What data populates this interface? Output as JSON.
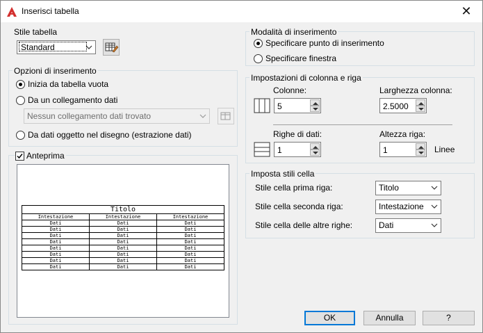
{
  "window": {
    "title": "Inserisci tabella",
    "close_glyph": "✕"
  },
  "stile_tabella": {
    "label": "Stile tabella",
    "value": "Standard"
  },
  "opzioni": {
    "label": "Opzioni di inserimento",
    "opt1": "Inizia da tabella vuota",
    "opt2": "Da un collegamento dati",
    "link_value": "Nessun collegamento dati trovato",
    "opt3": "Da dati oggetto nel disegno (estrazione dati)",
    "selected": "opt1"
  },
  "anteprima": {
    "label": "Anteprima",
    "checked": true,
    "table": {
      "title": "Titolo",
      "header": [
        "Intestazione",
        "Intestazione",
        "Intestazione"
      ],
      "rows": [
        [
          "Dati",
          "Dati",
          "Dati"
        ],
        [
          "Dati",
          "Dati",
          "Dati"
        ],
        [
          "Dati",
          "Dati",
          "Dati"
        ],
        [
          "Dati",
          "Dati",
          "Dati"
        ],
        [
          "Dati",
          "Dati",
          "Dati"
        ],
        [
          "Dati",
          "Dati",
          "Dati"
        ],
        [
          "Dati",
          "Dati",
          "Dati"
        ],
        [
          "Dati",
          "Dati",
          "Dati"
        ]
      ]
    }
  },
  "modalita": {
    "label": "Modalità di inserimento",
    "opt1": "Specificare punto di inserimento",
    "opt2": "Specificare finestra",
    "selected": "opt1"
  },
  "impostazioni": {
    "label": "Impostazioni di colonna e riga",
    "colonne_label": "Colonne:",
    "colonne_value": "5",
    "larghezza_label": "Larghezza colonna:",
    "larghezza_value": "2.5000",
    "righe_label": "Righe di dati:",
    "righe_value": "1",
    "altezza_label": "Altezza riga:",
    "altezza_value": "1",
    "linee_label": "Linee"
  },
  "stili_cella": {
    "label": "Imposta stili cella",
    "prima_label": "Stile cella prima riga:",
    "prima_value": "Titolo",
    "seconda_label": "Stile cella seconda riga:",
    "seconda_value": "Intestazione",
    "altre_label": "Stile cella delle altre righe:",
    "altre_value": "Dati"
  },
  "buttons": {
    "ok": "OK",
    "annulla": "Annulla",
    "help": "?"
  },
  "colors": {
    "accent": "#0078d7",
    "app_icon": "#d3302f"
  },
  "icons": [
    "autocad-app-icon",
    "close-icon",
    "chevron-down-icon",
    "table-style-icon",
    "data-link-icon",
    "columns-icon",
    "rows-icon",
    "spin-up-icon",
    "spin-down-icon",
    "checkmark-icon"
  ]
}
